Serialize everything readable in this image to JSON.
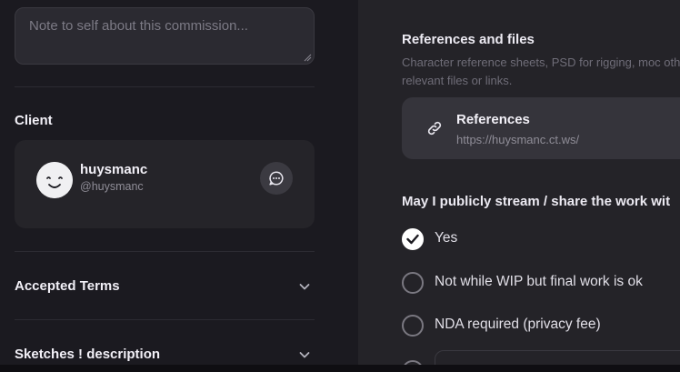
{
  "note": {
    "placeholder": "Note to self about this commission..."
  },
  "client": {
    "section_title": "Client",
    "name": "huysmanc",
    "handle": "@huysmanc"
  },
  "accordions": [
    {
      "label": "Accepted Terms"
    },
    {
      "label": "Sketches ! description"
    }
  ],
  "references": {
    "title": "References and files",
    "description": "Character reference sheets, PSD for rigging, moc other relevant files or links.",
    "card_title": "References",
    "card_url": "https://huysmanc.ct.ws/"
  },
  "stream_question": {
    "title": "May I publicly stream / share the work wit",
    "options": [
      {
        "label": "Yes",
        "checked": true
      },
      {
        "label": "Not while WIP but final work is ok",
        "checked": false
      },
      {
        "label": "NDA required (privacy fee)",
        "checked": false
      }
    ]
  },
  "colors": {
    "left_bg": "#1b1a20",
    "right_bg": "#242328",
    "card_bg": "#252429",
    "accent_text": "#f2f0f7"
  }
}
